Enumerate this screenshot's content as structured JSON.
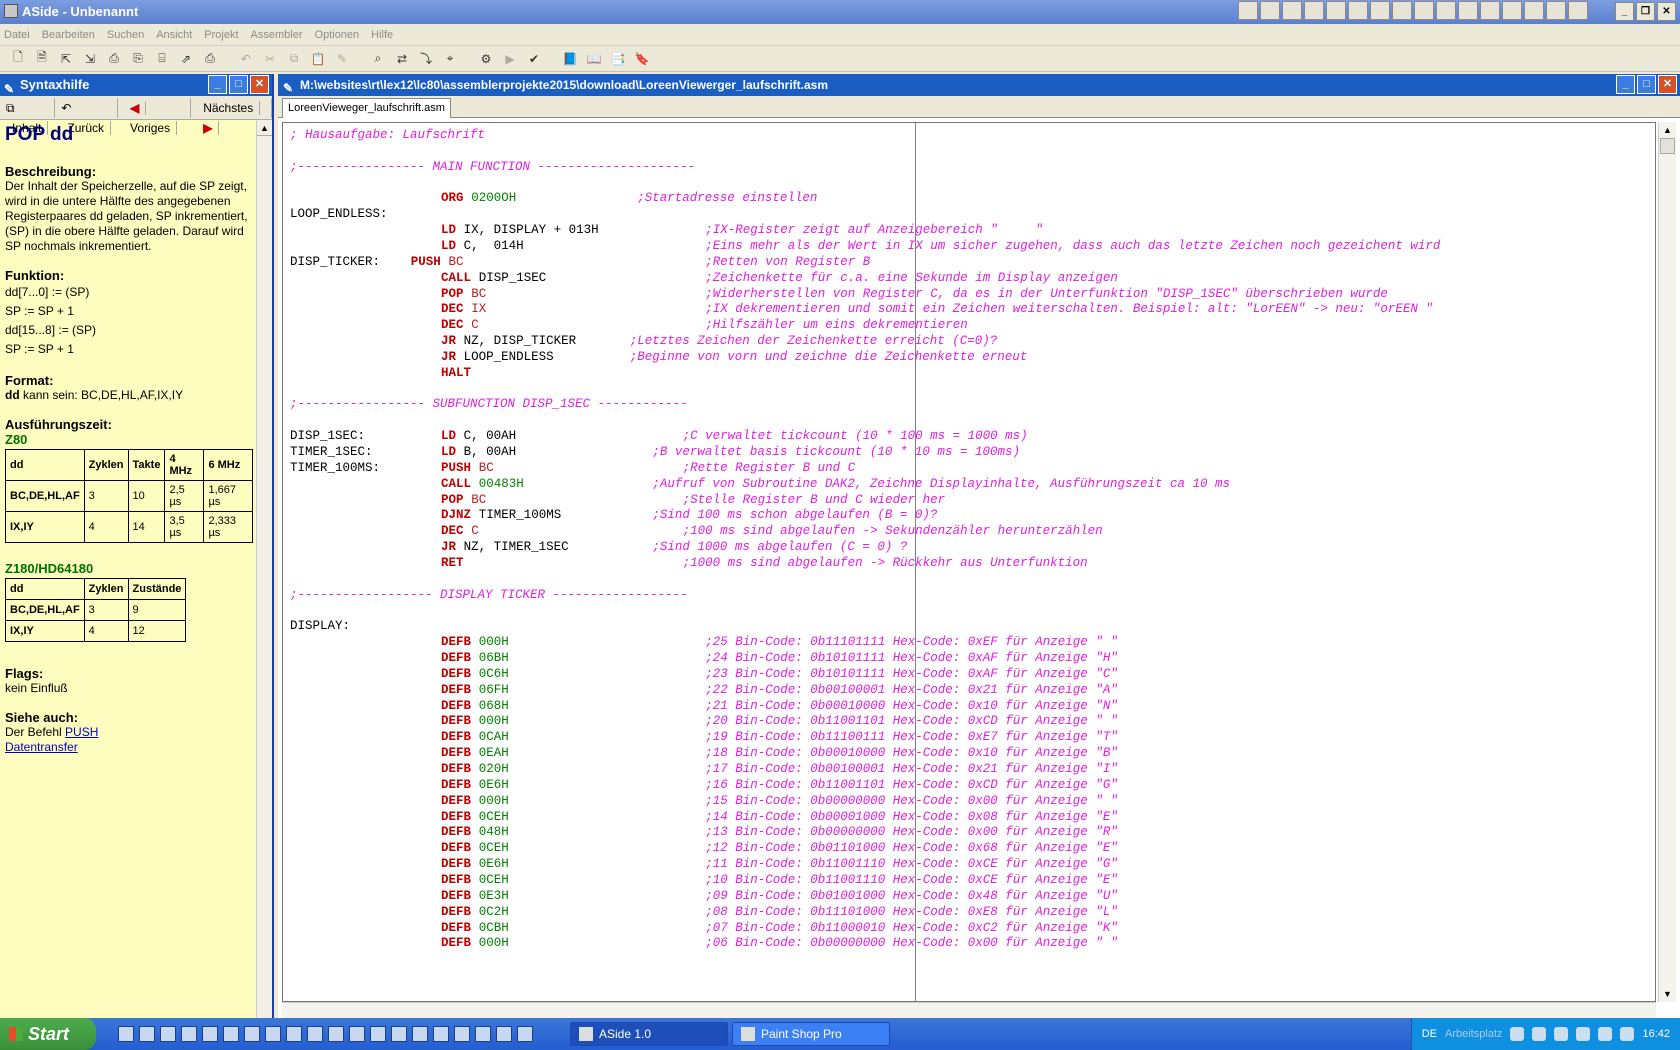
{
  "window": {
    "title": "ASide - Unbenannt"
  },
  "menu": [
    "Datei",
    "Bearbeiten",
    "Suchen",
    "Ansicht",
    "Projekt",
    "Assembler",
    "Optionen",
    "Hilfe"
  ],
  "help": {
    "title": "Syntaxhilfe",
    "nav": {
      "contents": "Inhalt",
      "back": "Zurück",
      "prev": "Voriges",
      "next": "Nächstes"
    },
    "heading": "POP dd",
    "desc_title": "Beschreibung",
    "desc_text": "Der Inhalt der Speicherzelle, auf die SP zeigt, wird in die untere Hälfte des angegebenen Registerpaares dd geladen, SP inkrementiert, (SP) in die obere Hälfte geladen. Darauf wird SP nochmals inkrementiert.",
    "func_title": "Funktion",
    "func_lines": [
      "dd[7...0] := (SP)",
      "SP := SP + 1",
      "dd[15...8] := (SP)",
      "SP := SP + 1"
    ],
    "format_title": "Format",
    "format_text": "kann sein: BC,DE,HL,AF,IX,IY",
    "format_bold": "dd",
    "time_title": "Ausführungszeit",
    "z80_label": "Z80",
    "z80_head": [
      "dd",
      "Zyklen",
      "Takte",
      "4 MHz",
      "6 MHz"
    ],
    "z80_rows": [
      [
        "BC,DE,HL,AF",
        "3",
        "10",
        "2,5 µs",
        "1,667 µs"
      ],
      [
        "IX,IY",
        "4",
        "14",
        "3,5 µs",
        "2,333 µs"
      ]
    ],
    "z180_label": "Z180/HD64180",
    "z180_head": [
      "dd",
      "Zyklen",
      "Zustände"
    ],
    "z180_rows": [
      [
        "BC,DE,HL,AF",
        "3",
        "9"
      ],
      [
        "IX,IY",
        "4",
        "12"
      ]
    ],
    "flags_title": "Flags",
    "flags_text": "kein Einfluß",
    "see_title": "Siehe auch",
    "see_prefix": "Der Befehl ",
    "see_link1": "PUSH",
    "see_link2": "Datentransfer"
  },
  "editor": {
    "title": "M:\\websites\\rt\\lex12\\lc80\\assemblerprojekte2015\\download\\LoreenViewerger_laufschrift.asm",
    "tab": "LoreenVieweger_laufschrift.asm"
  },
  "code": [
    {
      "c": "; Hausaufgabe: Laufschrift"
    },
    {},
    {
      "c": ";----------------- MAIN FUNCTION ---------------------"
    },
    {},
    {
      "i": "ORG",
      "o": "0200OH",
      "oc": "num",
      "c": ";Startadresse einstellen",
      "cx": "46"
    },
    {
      "l": "LOOP_ENDLESS:"
    },
    {
      "i": "LD",
      "o": "IX, DISPLAY + 013H",
      "c": ";IX-Register zeigt auf Anzeigebereich \"     \"",
      "cx": "55"
    },
    {
      "i": "LD",
      "o": "C,  014H",
      "c": ";Eins mehr als der Wert in IX um sicher zugehen, dass auch das letzte Zeichen noch gezeichent wird",
      "cx": "55"
    },
    {
      "l": "DISP_TICKER:",
      "i": "PUSH",
      "ix": "16",
      "o": "BC",
      "oc": "reg",
      "c": ";Retten von Register B",
      "cx": "55"
    },
    {
      "i": "CALL",
      "o": "DISP_1SEC",
      "c": ";Zeichenkette für c.a. eine Sekunde im Display anzeigen",
      "cx": "55"
    },
    {
      "i": "POP",
      "o": "BC",
      "oc": "reg",
      "c": ";Widerherstellen von Register C, da es in der Unterfunktion \"DISP_1SEC\" überschrieben wurde",
      "cx": "55"
    },
    {
      "i": "DEC",
      "o": "IX",
      "oc": "reg",
      "c": ";IX dekrementieren und somit ein Zeichen weiterschalten. Beispiel: alt: \"LorEEN\" -> neu: \"orEEN \"",
      "cx": "55"
    },
    {
      "i": "DEC",
      "o": "C",
      "oc": "reg",
      "c": ";Hilfszähler um eins dekrementieren",
      "cx": "55"
    },
    {
      "i": "JR",
      "o": "NZ, DISP_TICKER",
      "c": ";Letztes Zeichen der Zeichenkette erreicht (C=0)?",
      "cx": "45"
    },
    {
      "i": "JR",
      "o": "LOOP_ENDLESS",
      "c": ";Beginne von vorn und zeichne die Zeichenkette erneut",
      "cx": "45"
    },
    {
      "i": "HALT"
    },
    {},
    {
      "c": ";----------------- SUBFUNCTION DISP_1SEC ------------"
    },
    {},
    {
      "l": "DISP_1SEC:",
      "i": "LD",
      "o": "C, 00AH",
      "c": ";C verwaltet tickcount (10 * 100 ms = 1000 ms)",
      "cx": "52"
    },
    {
      "l": "TIMER_1SEC:",
      "i": "LD",
      "o": "B, 00AH",
      "c": ";B verwaltet basis tickcount (10 * 10 ms = 100ms)",
      "cx": "48"
    },
    {
      "l": "TIMER_100MS:",
      "i": "PUSH",
      "o": "BC",
      "oc": "reg",
      "c": ";Rette Register B und C",
      "cx": "52"
    },
    {
      "i": "CALL",
      "o": "00483H",
      "oc": "num",
      "c": ";Aufruf von Subroutine DAK2, Zeichne Displayinhalte, Ausführungszeit ca 10 ms",
      "cx": "48"
    },
    {
      "i": "POP",
      "o": "BC",
      "oc": "reg",
      "c": ";Stelle Register B und C wieder her",
      "cx": "52"
    },
    {
      "i": "DJNZ",
      "o": "TIMER_100MS",
      "c": ";Sind 100 ms schon abgelaufen (B = 0)?",
      "cx": "48"
    },
    {
      "i": "DEC",
      "o": "C",
      "oc": "reg",
      "c": ";100 ms sind abgelaufen -> Sekundenzähler herunterzählen",
      "cx": "52"
    },
    {
      "i": "JR",
      "o": "NZ, TIMER_1SEC",
      "c": ";Sind 1000 ms abgelaufen (C = 0) ?",
      "cx": "48"
    },
    {
      "i": "RET",
      "c": ";1000 ms sind abgelaufen -> Rückkehr aus Unterfunktion",
      "cx": "52"
    },
    {},
    {
      "c": ";------------------ DISPLAY TICKER ------------------"
    },
    {},
    {
      "l": "DISPLAY:"
    },
    {
      "i": "DEFB",
      "o": "000H",
      "oc": "num",
      "c": ";25 Bin-Code: 0b11101111 Hex-Code: 0xEF für Anzeige \" \"",
      "cx": "55"
    },
    {
      "i": "DEFB",
      "o": "06BH",
      "oc": "num",
      "c": ";24 Bin-Code: 0b10101111 Hex-Code: 0xAF für Anzeige \"H\"",
      "cx": "55"
    },
    {
      "i": "DEFB",
      "o": "0C6H",
      "oc": "num",
      "c": ";23 Bin-Code: 0b10101111 Hex-Code: 0xAF für Anzeige \"C\"",
      "cx": "55"
    },
    {
      "i": "DEFB",
      "o": "06FH",
      "oc": "num",
      "c": ";22 Bin-Code: 0b00100001 Hex-Code: 0x21 für Anzeige \"A\"",
      "cx": "55"
    },
    {
      "i": "DEFB",
      "o": "068H",
      "oc": "num",
      "c": ";21 Bin-Code: 0b00010000 Hex-Code: 0x10 für Anzeige \"N\"",
      "cx": "55"
    },
    {
      "i": "DEFB",
      "o": "000H",
      "oc": "num",
      "c": ";20 Bin-Code: 0b11001101 Hex-Code: 0xCD für Anzeige \" \"",
      "cx": "55"
    },
    {
      "i": "DEFB",
      "o": "0CAH",
      "oc": "num",
      "c": ";19 Bin-Code: 0b11100111 Hex-Code: 0xE7 für Anzeige \"T\"",
      "cx": "55"
    },
    {
      "i": "DEFB",
      "o": "0EAH",
      "oc": "num",
      "c": ";18 Bin-Code: 0b00010000 Hex-Code: 0x10 für Anzeige \"B\"",
      "cx": "55"
    },
    {
      "i": "DEFB",
      "o": "020H",
      "oc": "num",
      "c": ";17 Bin-Code: 0b00100001 Hex-Code: 0x21 für Anzeige \"I\"",
      "cx": "55"
    },
    {
      "i": "DEFB",
      "o": "0E6H",
      "oc": "num",
      "c": ";16 Bin-Code: 0b11001101 Hex-Code: 0xCD für Anzeige \"G\"",
      "cx": "55"
    },
    {
      "i": "DEFB",
      "o": "000H",
      "oc": "num",
      "c": ";15 Bin-Code: 0b00000000 Hex-Code: 0x00 für Anzeige \" \"",
      "cx": "55"
    },
    {
      "i": "DEFB",
      "o": "0CEH",
      "oc": "num",
      "c": ";14 Bin-Code: 0b00001000 Hex-Code: 0x08 für Anzeige \"E\"",
      "cx": "55"
    },
    {
      "i": "DEFB",
      "o": "048H",
      "oc": "num",
      "c": ";13 Bin-Code: 0b00000000 Hex-Code: 0x00 für Anzeige \"R\"",
      "cx": "55"
    },
    {
      "i": "DEFB",
      "o": "0CEH",
      "oc": "num",
      "c": ";12 Bin-Code: 0b01101000 Hex-Code: 0x68 für Anzeige \"E\"",
      "cx": "55"
    },
    {
      "i": "DEFB",
      "o": "0E6H",
      "oc": "num",
      "c": ";11 Bin-Code: 0b11001110 Hex-Code: 0xCE für Anzeige \"G\"",
      "cx": "55"
    },
    {
      "i": "DEFB",
      "o": "0CEH",
      "oc": "num",
      "c": ";10 Bin-Code: 0b11001110 Hex-Code: 0xCE für Anzeige \"E\"",
      "cx": "55"
    },
    {
      "i": "DEFB",
      "o": "0E3H",
      "oc": "num",
      "c": ";09 Bin-Code: 0b01001000 Hex-Code: 0x48 für Anzeige \"U\"",
      "cx": "55"
    },
    {
      "i": "DEFB",
      "o": "0C2H",
      "oc": "num",
      "c": ";08 Bin-Code: 0b11101000 Hex-Code: 0xE8 für Anzeige \"L\"",
      "cx": "55"
    },
    {
      "i": "DEFB",
      "o": "0CBH",
      "oc": "num",
      "c": ";07 Bin-Code: 0b11000010 Hex-Code: 0xC2 für Anzeige \"K\"",
      "cx": "55"
    },
    {
      "i": "DEFB",
      "o": "000H",
      "oc": "num",
      "c": ";06 Bin-Code: 0b00000000 Hex-Code: 0x00 für Anzeige \" \"",
      "cx": "55"
    }
  ],
  "taskbar": {
    "start": "Start",
    "tasks": [
      {
        "label": "ASide 1.0",
        "active": true
      },
      {
        "label": "Paint Shop Pro",
        "active": false
      }
    ],
    "lang": "DE",
    "workspace": "Arbeitsplatz",
    "time": "16:42"
  }
}
